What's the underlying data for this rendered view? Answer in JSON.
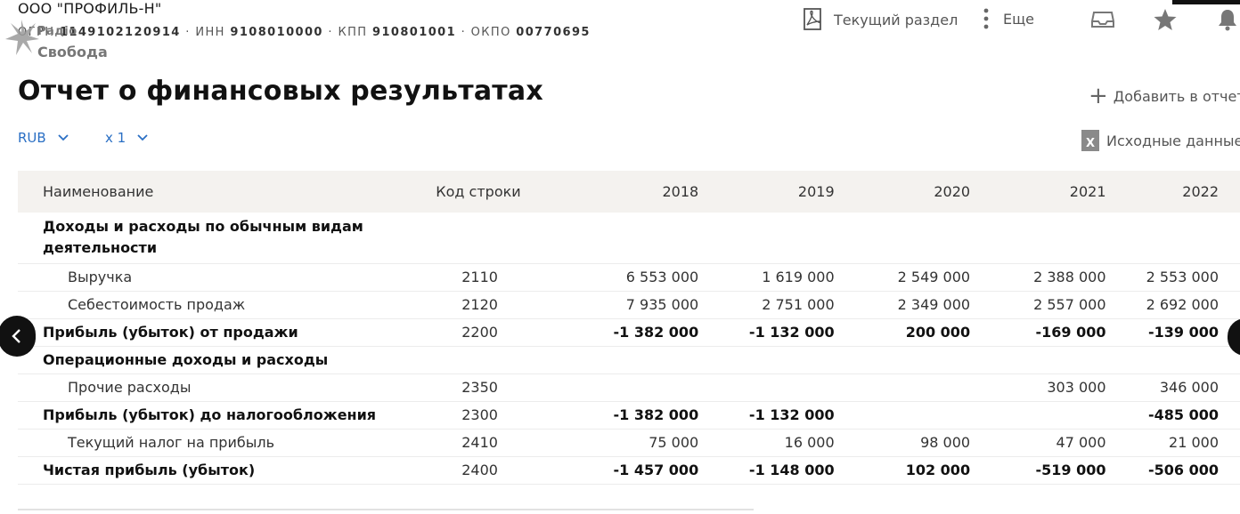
{
  "company": {
    "name": "ООО \"ПРОФИЛЬ-Н\"",
    "ogrn_label": "ОГРН",
    "ogrn": "1149102120914",
    "inn_label": "ИНН",
    "inn": "9108010000",
    "kpp_label": "КПП",
    "kpp": "910801001",
    "okpo_label": "ОКПО",
    "okpo": "00770695"
  },
  "watermark": {
    "line1": "Радіо",
    "line2": "Свобода"
  },
  "header": {
    "current_section": "Текущий раздел",
    "more": "Еще"
  },
  "page": {
    "title": "Отчет о финансовых результатах",
    "add_to_report": "Добавить в отчет",
    "source_data": "Исходные данные",
    "currency": "RUB",
    "scale": "x 1"
  },
  "table": {
    "headers": {
      "name": "Наименование",
      "code": "Код строки",
      "y2018": "2018",
      "y2019": "2019",
      "y2020": "2020",
      "y2021": "2021",
      "y2022": "2022"
    },
    "rows": [
      {
        "name": "Доходы и расходы по обычным видам деятельности",
        "code": "",
        "y2018": "",
        "y2019": "",
        "y2020": "",
        "y2021": "",
        "y2022": ""
      },
      {
        "name": "Выручка",
        "code": "2110",
        "y2018": "6 553 000",
        "y2019": "1 619 000",
        "y2020": "2 549 000",
        "y2021": "2 388 000",
        "y2022": "2 553 000"
      },
      {
        "name": "Себестоимость продаж",
        "code": "2120",
        "y2018": "7 935 000",
        "y2019": "2 751 000",
        "y2020": "2 349 000",
        "y2021": "2 557 000",
        "y2022": "2 692 000"
      },
      {
        "name": "Прибыль (убыток) от продажи",
        "code": "2200",
        "y2018": "-1 382 000",
        "y2019": "-1 132 000",
        "y2020": "200 000",
        "y2021": "-169 000",
        "y2022": "-139 000"
      },
      {
        "name": "Операционные доходы и расходы",
        "code": "",
        "y2018": "",
        "y2019": "",
        "y2020": "",
        "y2021": "",
        "y2022": ""
      },
      {
        "name": "Прочие расходы",
        "code": "2350",
        "y2018": "",
        "y2019": "",
        "y2020": "",
        "y2021": "303 000",
        "y2022": "346 000"
      },
      {
        "name": "Прибыль (убыток) до налогообложения",
        "code": "2300",
        "y2018": "-1 382 000",
        "y2019": "-1 132 000",
        "y2020": "",
        "y2021": "",
        "y2022": "-485 000"
      },
      {
        "name": "Текущий налог на прибыль",
        "code": "2410",
        "y2018": "75 000",
        "y2019": "16 000",
        "y2020": "98 000",
        "y2021": "47 000",
        "y2022": "21 000"
      },
      {
        "name": "Чистая прибыль (убыток)",
        "code": "2400",
        "y2018": "-1 457 000",
        "y2019": "-1 148 000",
        "y2020": "102 000",
        "y2021": "-519 000",
        "y2022": "-506 000"
      }
    ]
  }
}
